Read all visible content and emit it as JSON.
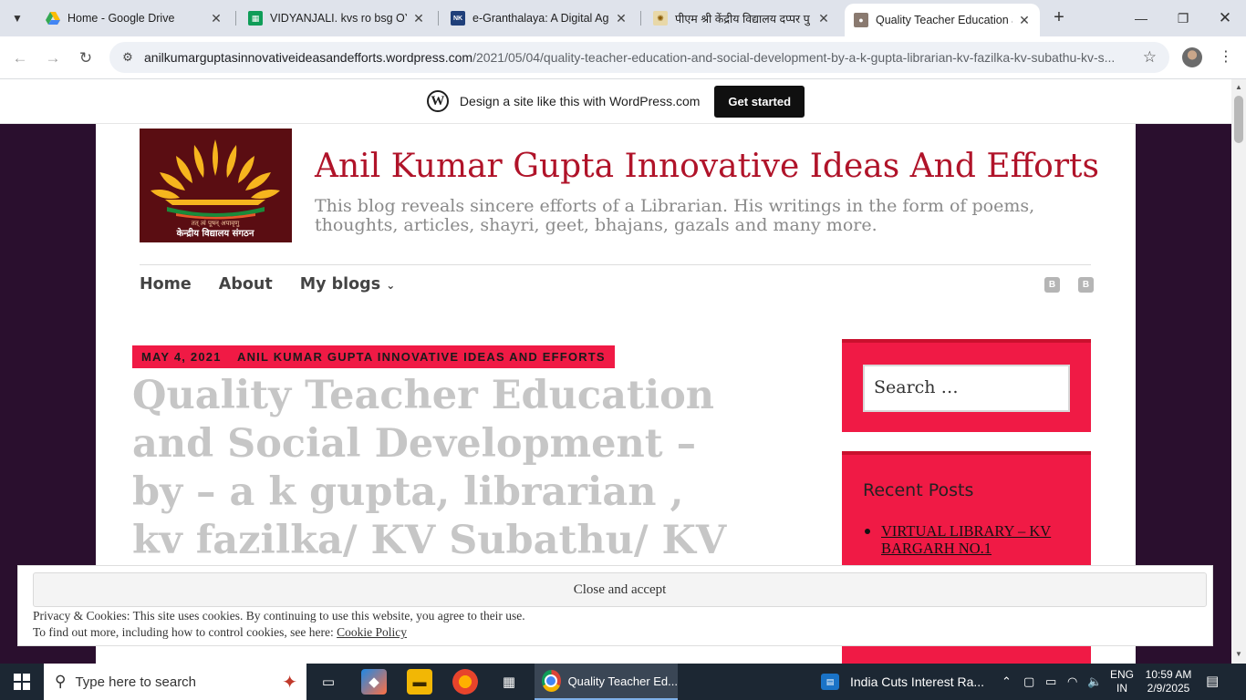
{
  "browser": {
    "tabs": [
      {
        "title": "Home - Google Drive",
        "favicon": "google-drive-icon"
      },
      {
        "title": "VIDYANJALI. kvs ro bsg OYM",
        "favicon": "google-sheets-icon"
      },
      {
        "title": "e-Granthalaya: A Digital Age",
        "favicon": "nic-icon"
      },
      {
        "title": "पीएम श्री केंद्रीय विद्यालय दप्पर पु",
        "favicon": "kv-icon"
      },
      {
        "title": "Quality Teacher Education ar",
        "favicon": "profile-photo-icon",
        "active": true
      }
    ],
    "url_host": "anilkumarguptasinnovativeideasandefforts.wordpress.com",
    "url_path": "/2021/05/04/quality-teacher-education-and-social-development-by-a-k-gupta-librarian-kv-fazilka-kv-subathu-kv-s..."
  },
  "wpbar": {
    "text": "Design a site like this with WordPress.com",
    "button": "Get started"
  },
  "site": {
    "logo_text": "केन्द्रीय विद्यालय संगठन",
    "logo_motto": "तत् त्वं पूषन् अपावृणु",
    "title": "Anil Kumar Gupta Innovative Ideas And Efforts",
    "description": "This blog reveals sincere efforts of a Librarian. His writings in the form of poems, thoughts, articles, shayri, geet, bhajans, gazals and many more."
  },
  "nav": {
    "items": [
      "Home",
      "About",
      "My blogs"
    ],
    "dropdown_icon": "chevron-down-icon"
  },
  "post": {
    "date": "MAY 4, 2021",
    "category": "ANIL KUMAR GUPTA INNOVATIVE IDEAS AND EFFORTS",
    "title": "Quality Teacher Education and Social Development – by – a k gupta, librarian , kv fazilka/ KV Subathu/ KV Seoni"
  },
  "sidebar": {
    "search_placeholder": "Search …",
    "recent_title": "Recent Posts",
    "recent_posts": [
      "VIRTUAL LIBRARY – KV BARGARH NO.1"
    ]
  },
  "cookie": {
    "button": "Close and accept",
    "line1": "Privacy & Cookies: This site uses cookies. By continuing to use this website, you agree to their use.",
    "line2_prefix": "To find out more, including how to control cookies, see here: ",
    "link": "Cookie Policy"
  },
  "taskbar": {
    "search_placeholder": "Type here to search",
    "chrome_label": "Quality Teacher Ed...",
    "news": "India Cuts Interest Ra...",
    "lang_1": "ENG",
    "lang_2": "IN",
    "time": "10:59 AM",
    "date": "2/9/2025"
  },
  "colors": {
    "accent": "#f01a45",
    "title_red": "#b01329",
    "page_bg": "#2a0f2e"
  }
}
